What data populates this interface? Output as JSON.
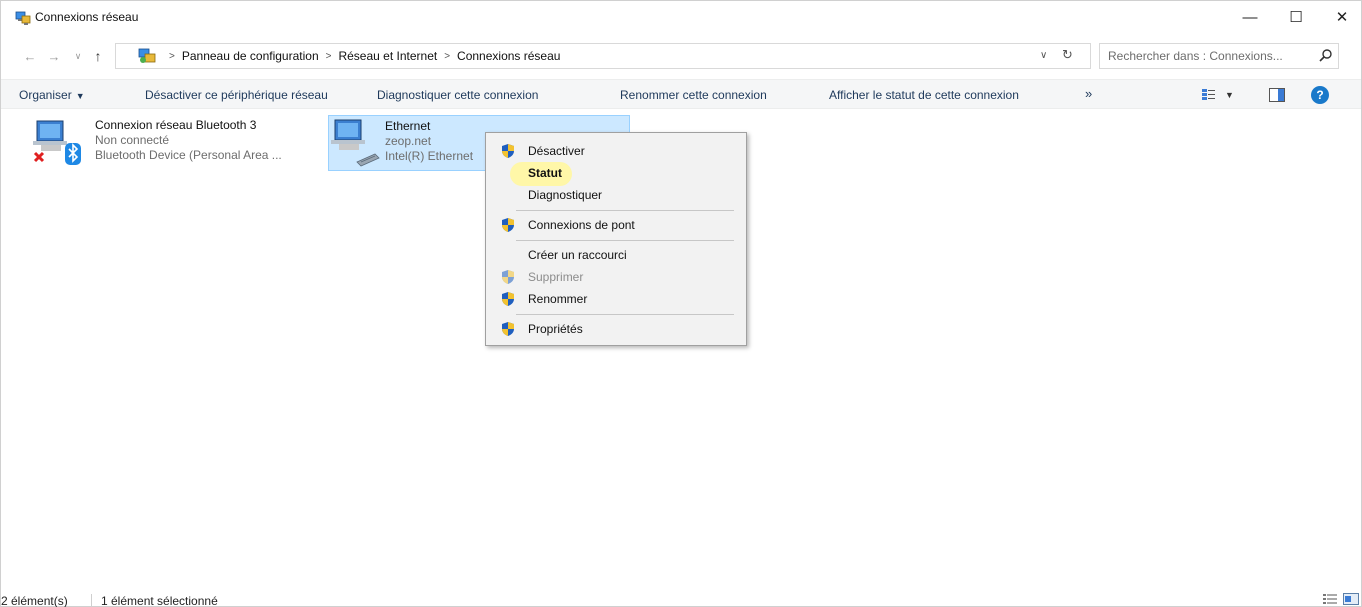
{
  "window": {
    "title": "Connexions réseau",
    "controls": {
      "minimize": "—",
      "maximize": "☐",
      "close": "✕"
    }
  },
  "address": {
    "breadcrumbs": [
      "Panneau de configuration",
      "Réseau et Internet",
      "Connexions réseau"
    ],
    "search_placeholder": "Rechercher dans : Connexions..."
  },
  "toolbar": {
    "organize": "Organiser",
    "commands": [
      "Désactiver ce périphérique réseau",
      "Diagnostiquer cette connexion",
      "Renommer cette connexion",
      "Afficher le statut de cette connexion"
    ],
    "more": "»",
    "help": "?"
  },
  "items": [
    {
      "name": "Connexion réseau Bluetooth 3",
      "status": "Non connecté",
      "device": "Bluetooth Device (Personal Area ..."
    },
    {
      "name": "Ethernet",
      "status": "zeop.net",
      "device": "Intel(R) Ethernet"
    }
  ],
  "context_menu": {
    "items": [
      {
        "label": "Désactiver",
        "shield": true
      },
      {
        "label": "Statut",
        "bold": true
      },
      {
        "label": "Diagnostiquer"
      },
      {
        "label": "Connexions de pont",
        "shield": true
      },
      {
        "label": "Créer un raccourci"
      },
      {
        "label": "Supprimer",
        "shield": true,
        "disabled": true
      },
      {
        "label": "Renommer",
        "shield": true
      },
      {
        "label": "Propriétés",
        "shield": true
      }
    ],
    "highlight_color": "#fff7a3"
  },
  "statusbar": {
    "count": "2 élément(s)",
    "selection": "1 élément sélectionné"
  },
  "colors": {
    "selection_bg": "#cce8ff",
    "selection_border": "#99d1ff",
    "link_text": "#1e395b",
    "help_blue": "#1979ca"
  }
}
